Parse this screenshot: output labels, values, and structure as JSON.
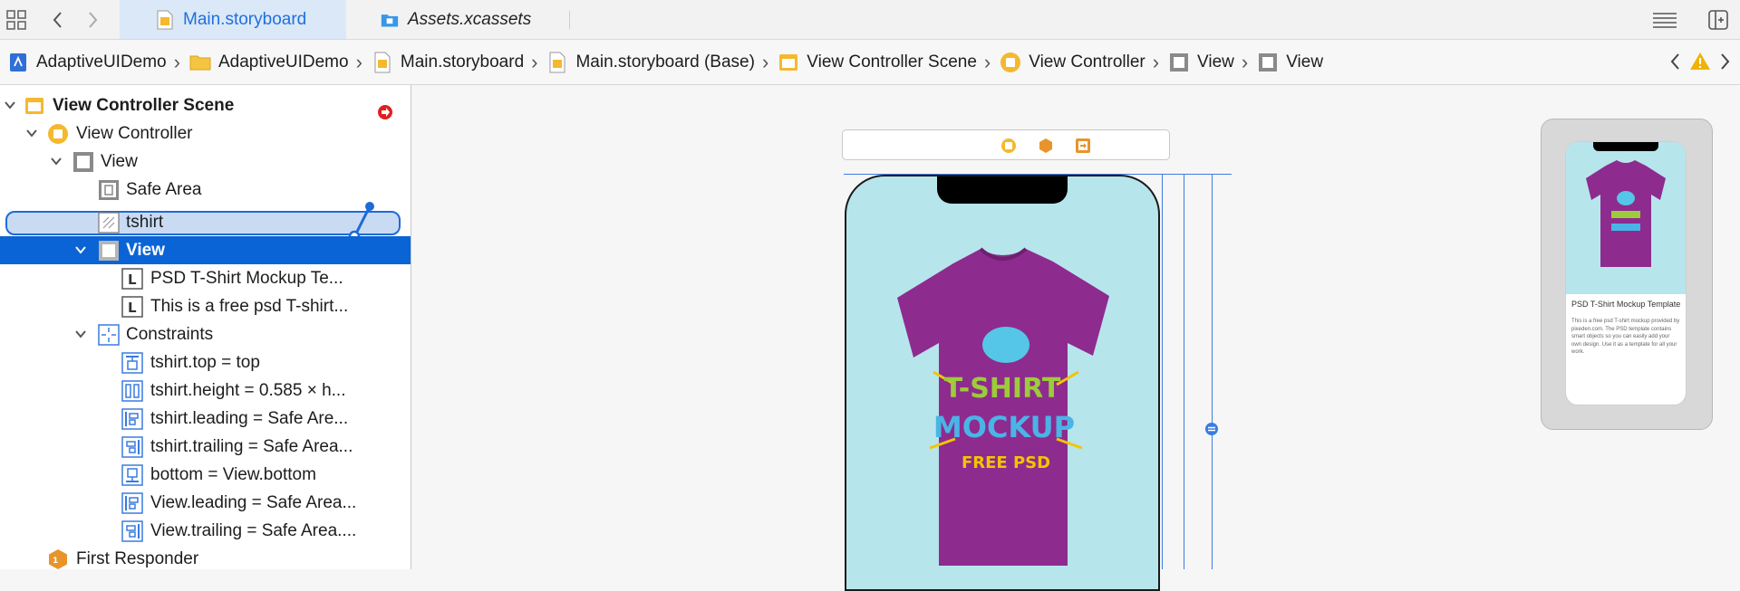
{
  "tabs": [
    {
      "label": "Main.storyboard",
      "active": true
    },
    {
      "label": "Assets.xcassets",
      "active": false
    }
  ],
  "breadcrumbs": [
    {
      "label": "AdaptiveUIDemo",
      "icon": "project-icon"
    },
    {
      "label": "AdaptiveUIDemo",
      "icon": "folder-icon"
    },
    {
      "label": "Main.storyboard",
      "icon": "storyboard-file-icon"
    },
    {
      "label": "Main.storyboard (Base)",
      "icon": "storyboard-file-icon"
    },
    {
      "label": "View Controller Scene",
      "icon": "scene-icon"
    },
    {
      "label": "View Controller",
      "icon": "view-controller-icon"
    },
    {
      "label": "View",
      "icon": "view-icon"
    },
    {
      "label": "View",
      "icon": "view-icon"
    }
  ],
  "navigator": {
    "scene": "View Controller Scene",
    "view_controller": "View Controller",
    "view": "View",
    "safe_area": "Safe Area",
    "tshirt": "tshirt",
    "selected_view": "View",
    "label1": "PSD T-Shirt Mockup Te...",
    "label2": "This is a free psd T-shirt...",
    "constraints": "Constraints",
    "constraint_items": [
      "tshirt.top = top",
      "tshirt.height = 0.585 × h...",
      "tshirt.leading = Safe Are...",
      "tshirt.trailing = Safe Area...",
      "bottom = View.bottom",
      "View.leading = Safe Area...",
      "View.trailing = Safe Area...."
    ],
    "first_responder": "First Responder"
  },
  "canvas": {
    "tshirt_print_lines": [
      "T-SHIRT",
      "MOCKUP",
      "FREE PSD"
    ],
    "preview_title": "PSD T-Shirt Mockup Template",
    "preview_body": "This is a free psd T-shirt mockup provided by pixeden.com. The PSD template contains smart objects so you can easily add your own design. Use it as a template for all your work."
  },
  "colors": {
    "accent": "#0a64d6",
    "tab_active_bg": "#dbe8f7",
    "shirt": "#8e2b8f",
    "canvas_bg": "#b7e5ec",
    "scene_icon": "#f5b82e",
    "first_responder": "#e8942a"
  }
}
